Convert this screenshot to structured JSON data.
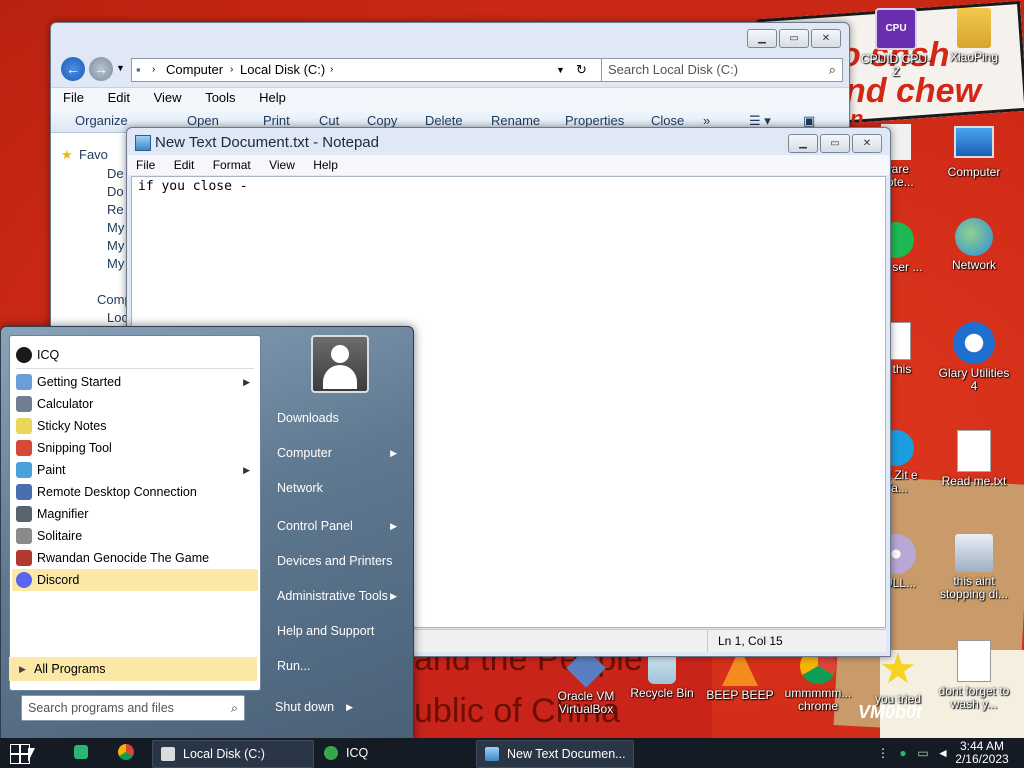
{
  "wallpaper": {
    "text_top_1": "o shsh",
    "text_top_2": "nd chew",
    "text_top_3": "n...",
    "text_bottom_1": "and the People's",
    "text_bottom_2": "ublic of China",
    "watermark": "VM0b0t"
  },
  "desktop_icons": [
    {
      "label": "CPUID CPU-Z",
      "icon": "cpuz-icon"
    },
    {
      "label": "XiaoPing",
      "icon": "person-icon"
    },
    {
      "label": "ware Note...",
      "icon": "note-icon"
    },
    {
      "label": "Computer",
      "icon": "computer-icon"
    },
    {
      "label": "sed ser ...",
      "icon": "spotify-icon"
    },
    {
      "label": "Network",
      "icon": "network-icon"
    },
    {
      "label": "is this",
      "icon": "document-icon"
    },
    {
      "label": "Glary Utilities 4",
      "icon": "glary-icon"
    },
    {
      "label": "hat Zit e Ya...",
      "icon": "skype-icon"
    },
    {
      "label": "Read me.txt",
      "icon": "textfile-icon"
    },
    {
      "label": "BULL...",
      "icon": "disc-icon"
    },
    {
      "label": "this aint stopping di...",
      "icon": "setup-icon"
    },
    {
      "label": "Oracle VM VirtualBox",
      "icon": "virtualbox-icon"
    },
    {
      "label": "Recycle Bin",
      "icon": "recycle-bin-icon"
    },
    {
      "label": "BEEP BEEP",
      "icon": "vlc-icon"
    },
    {
      "label": "ummmmm... chrome",
      "icon": "chrome-icon"
    },
    {
      "label": "you tried",
      "icon": "star-icon"
    },
    {
      "label": "dont forget to wash y...",
      "icon": "document-icon"
    }
  ],
  "explorer": {
    "breadcrumb": [
      "Computer",
      "Local Disk (C:)"
    ],
    "search_placeholder": "Search Local Disk (C:)",
    "menu": [
      "File",
      "Edit",
      "View",
      "Tools",
      "Help"
    ],
    "commands": [
      "Organize",
      "Open",
      "Print",
      "Cut",
      "Copy",
      "Delete",
      "Rename",
      "Properties",
      "Close",
      "»"
    ],
    "nav_favorites": "Favo",
    "nav_items": [
      "De",
      "Do",
      "Re",
      "My",
      "My",
      "My"
    ],
    "nav_computer": "Comp",
    "nav_local": "Loc"
  },
  "notepad": {
    "title": "New Text Document.txt - Notepad",
    "menu": [
      "File",
      "Edit",
      "Format",
      "View",
      "Help"
    ],
    "content": "if you close -",
    "status_pos": "Ln 1, Col 15"
  },
  "startmenu": {
    "pinned": [
      {
        "label": "ICQ",
        "color": "#3aa64a"
      }
    ],
    "programs": [
      {
        "label": "Getting Started",
        "submenu": true,
        "color": "#6a9ed6"
      },
      {
        "label": "Calculator",
        "submenu": false,
        "color": "#6f7f92"
      },
      {
        "label": "Sticky Notes",
        "submenu": false,
        "color": "#e8d65c"
      },
      {
        "label": "Snipping Tool",
        "submenu": false,
        "color": "#d64a3a"
      },
      {
        "label": "Paint",
        "submenu": true,
        "color": "#4aa0d8"
      },
      {
        "label": "Remote Desktop Connection",
        "submenu": false,
        "color": "#4a6fb0"
      },
      {
        "label": "Magnifier",
        "submenu": false,
        "color": "#5a6470"
      },
      {
        "label": "Solitaire",
        "submenu": false,
        "color": "#8a8a8a"
      },
      {
        "label": "Rwandan Genocide The Game",
        "submenu": false,
        "color": "#b03a2e"
      },
      {
        "label": "Discord",
        "submenu": false,
        "color": "#5865f2"
      }
    ],
    "all_programs": "All Programs",
    "search_placeholder": "Search programs and files",
    "right_items": [
      {
        "label": "Downloads",
        "submenu": false
      },
      {
        "label": "Computer",
        "submenu": true
      },
      {
        "label": "Network",
        "submenu": false
      },
      {
        "label": "Control Panel",
        "submenu": true
      },
      {
        "label": "Devices and Printers",
        "submenu": false
      },
      {
        "label": "Administrative Tools",
        "submenu": true
      },
      {
        "label": "Help and Support",
        "submenu": false
      },
      {
        "label": "Run...",
        "submenu": false
      }
    ],
    "shutdown": "Shut down"
  },
  "taskbar": {
    "buttons": [
      {
        "label": "Local Disk (C:)",
        "icon": "folder-icon"
      },
      {
        "label": "ICQ",
        "icon": "icq-icon"
      },
      {
        "label": "New Text Documen...",
        "icon": "notepad-icon"
      }
    ],
    "time": "3:44 AM",
    "date": "2/16/2023"
  }
}
